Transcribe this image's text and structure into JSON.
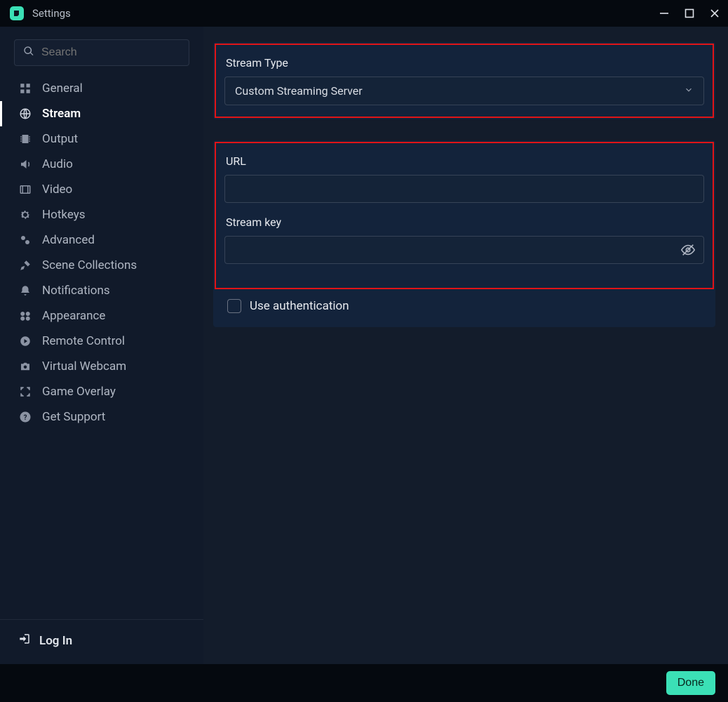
{
  "window": {
    "title": "Settings"
  },
  "sidebar": {
    "search_placeholder": "Search",
    "items": [
      {
        "id": "general",
        "label": "General"
      },
      {
        "id": "stream",
        "label": "Stream"
      },
      {
        "id": "output",
        "label": "Output"
      },
      {
        "id": "audio",
        "label": "Audio"
      },
      {
        "id": "video",
        "label": "Video"
      },
      {
        "id": "hotkeys",
        "label": "Hotkeys"
      },
      {
        "id": "advanced",
        "label": "Advanced"
      },
      {
        "id": "scene-collections",
        "label": "Scene Collections"
      },
      {
        "id": "notifications",
        "label": "Notifications"
      },
      {
        "id": "appearance",
        "label": "Appearance"
      },
      {
        "id": "remote-control",
        "label": "Remote Control"
      },
      {
        "id": "virtual-webcam",
        "label": "Virtual Webcam"
      },
      {
        "id": "game-overlay",
        "label": "Game Overlay"
      },
      {
        "id": "get-support",
        "label": "Get Support"
      }
    ],
    "active_id": "stream",
    "login_label": "Log In"
  },
  "main": {
    "stream_type": {
      "label": "Stream Type",
      "selected": "Custom Streaming Server"
    },
    "url": {
      "label": "URL",
      "value": ""
    },
    "stream_key": {
      "label": "Stream key",
      "value": ""
    },
    "use_auth": {
      "label": "Use authentication",
      "checked": false
    }
  },
  "footer": {
    "done_label": "Done"
  }
}
